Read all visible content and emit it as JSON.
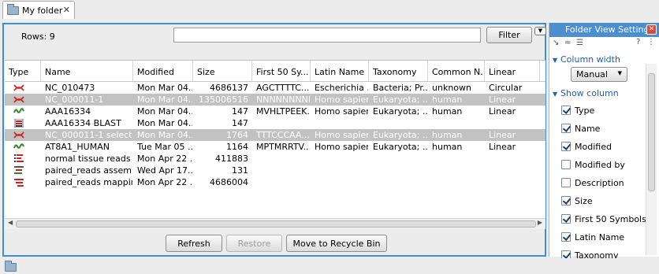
{
  "tab": {
    "label": "My folder",
    "close": "✕"
  },
  "toolbar": {
    "rows_label": "Rows: 9",
    "filter_value": "",
    "filter_button": "Filter"
  },
  "table": {
    "columns": [
      "Type",
      "Name",
      "Modified",
      "Size",
      "First 50 Sy...",
      "Latin Name",
      "Taxonomy",
      "Common N...",
      "Linear"
    ],
    "rows": [
      {
        "icon": "dna-red-icon",
        "name": "NC_010473",
        "modified": "Mon Mar 04...",
        "size": "4686137",
        "first50": "AGCTTTTC...",
        "latin": "Escherichia ...",
        "taxonomy": "Bacteria; Pr...",
        "common": "unknown",
        "linear": "Circular",
        "selected": false
      },
      {
        "icon": "dna-red-icon",
        "name": "NC_000011-1",
        "modified": "Mon Mar 04...",
        "size": "135006516",
        "first50": "NNNNNNNNN...",
        "latin": "Homo sapiens",
        "taxonomy": "Eukaryota; ...",
        "common": "human",
        "linear": "Linear",
        "selected": true
      },
      {
        "icon": "protein-green-icon",
        "name": "AAA16334",
        "modified": "Mon Mar 04...",
        "size": "147",
        "first50": "MVHLTPEEK...",
        "latin": "Homo sapiens",
        "taxonomy": "Eukaryota; ...",
        "common": "human",
        "linear": "Linear",
        "selected": false
      },
      {
        "icon": "blast-icon",
        "name": "AAA16334 BLAST",
        "modified": "Mon Mar 04...",
        "size": "147",
        "first50": "",
        "latin": "",
        "taxonomy": "",
        "common": "",
        "linear": "",
        "selected": false
      },
      {
        "icon": "dna-red-icon",
        "name": "NC_000011-1 selection",
        "modified": "Mon Mar 04...",
        "size": "1764",
        "first50": "TTTCCCAA...",
        "latin": "Homo sapiens",
        "taxonomy": "Eukaryota; ...",
        "common": "human",
        "linear": "Linear",
        "selected": true
      },
      {
        "icon": "protein-green-icon",
        "name": "AT8A1_HUMAN",
        "modified": "Tue Mar 05 ...",
        "size": "1164",
        "first50": "MPTMRRTV...",
        "latin": "Homo sapiens",
        "taxonomy": "Eukaryota; ...",
        "common": "human",
        "linear": "Linear",
        "selected": false
      },
      {
        "icon": "reads-icon",
        "name": "normal tissue reads",
        "modified": "Mon Apr 22 ...",
        "size": "411883",
        "first50": "",
        "latin": "",
        "taxonomy": "",
        "common": "",
        "linear": "",
        "selected": false
      },
      {
        "icon": "assembly-icon",
        "name": "paired_reads assembly",
        "modified": "Wed Apr 17...",
        "size": "131",
        "first50": "",
        "latin": "",
        "taxonomy": "",
        "common": "",
        "linear": "",
        "selected": false
      },
      {
        "icon": "mapping-icon",
        "name": "paired_reads mapping",
        "modified": "Mon Apr 22 ...",
        "size": "4686004",
        "first50": "",
        "latin": "",
        "taxonomy": "",
        "common": "",
        "linear": "",
        "selected": false
      }
    ]
  },
  "actions": {
    "refresh": "Refresh",
    "restore": "Restore",
    "recycle": "Move to Recycle Bin"
  },
  "side": {
    "title": "Folder View Settings",
    "help": "?",
    "column_width_label": "Column width",
    "column_width_value": "Manual",
    "show_column_label": "Show column",
    "columns": [
      {
        "label": "Type",
        "checked": true
      },
      {
        "label": "Name",
        "checked": true
      },
      {
        "label": "Modified",
        "checked": true
      },
      {
        "label": "Modified by",
        "checked": false
      },
      {
        "label": "Description",
        "checked": false
      },
      {
        "label": "Size",
        "checked": true
      },
      {
        "label": "First 50 Symbols",
        "checked": true
      },
      {
        "label": "Latin Name",
        "checked": true
      },
      {
        "label": "Taxonomy",
        "checked": true
      }
    ]
  },
  "colors": {
    "accent": "#3d8fd6",
    "side_title": "#4b8ed1",
    "selected_row": "#c2c2c2",
    "section_text": "#1f5fad"
  }
}
